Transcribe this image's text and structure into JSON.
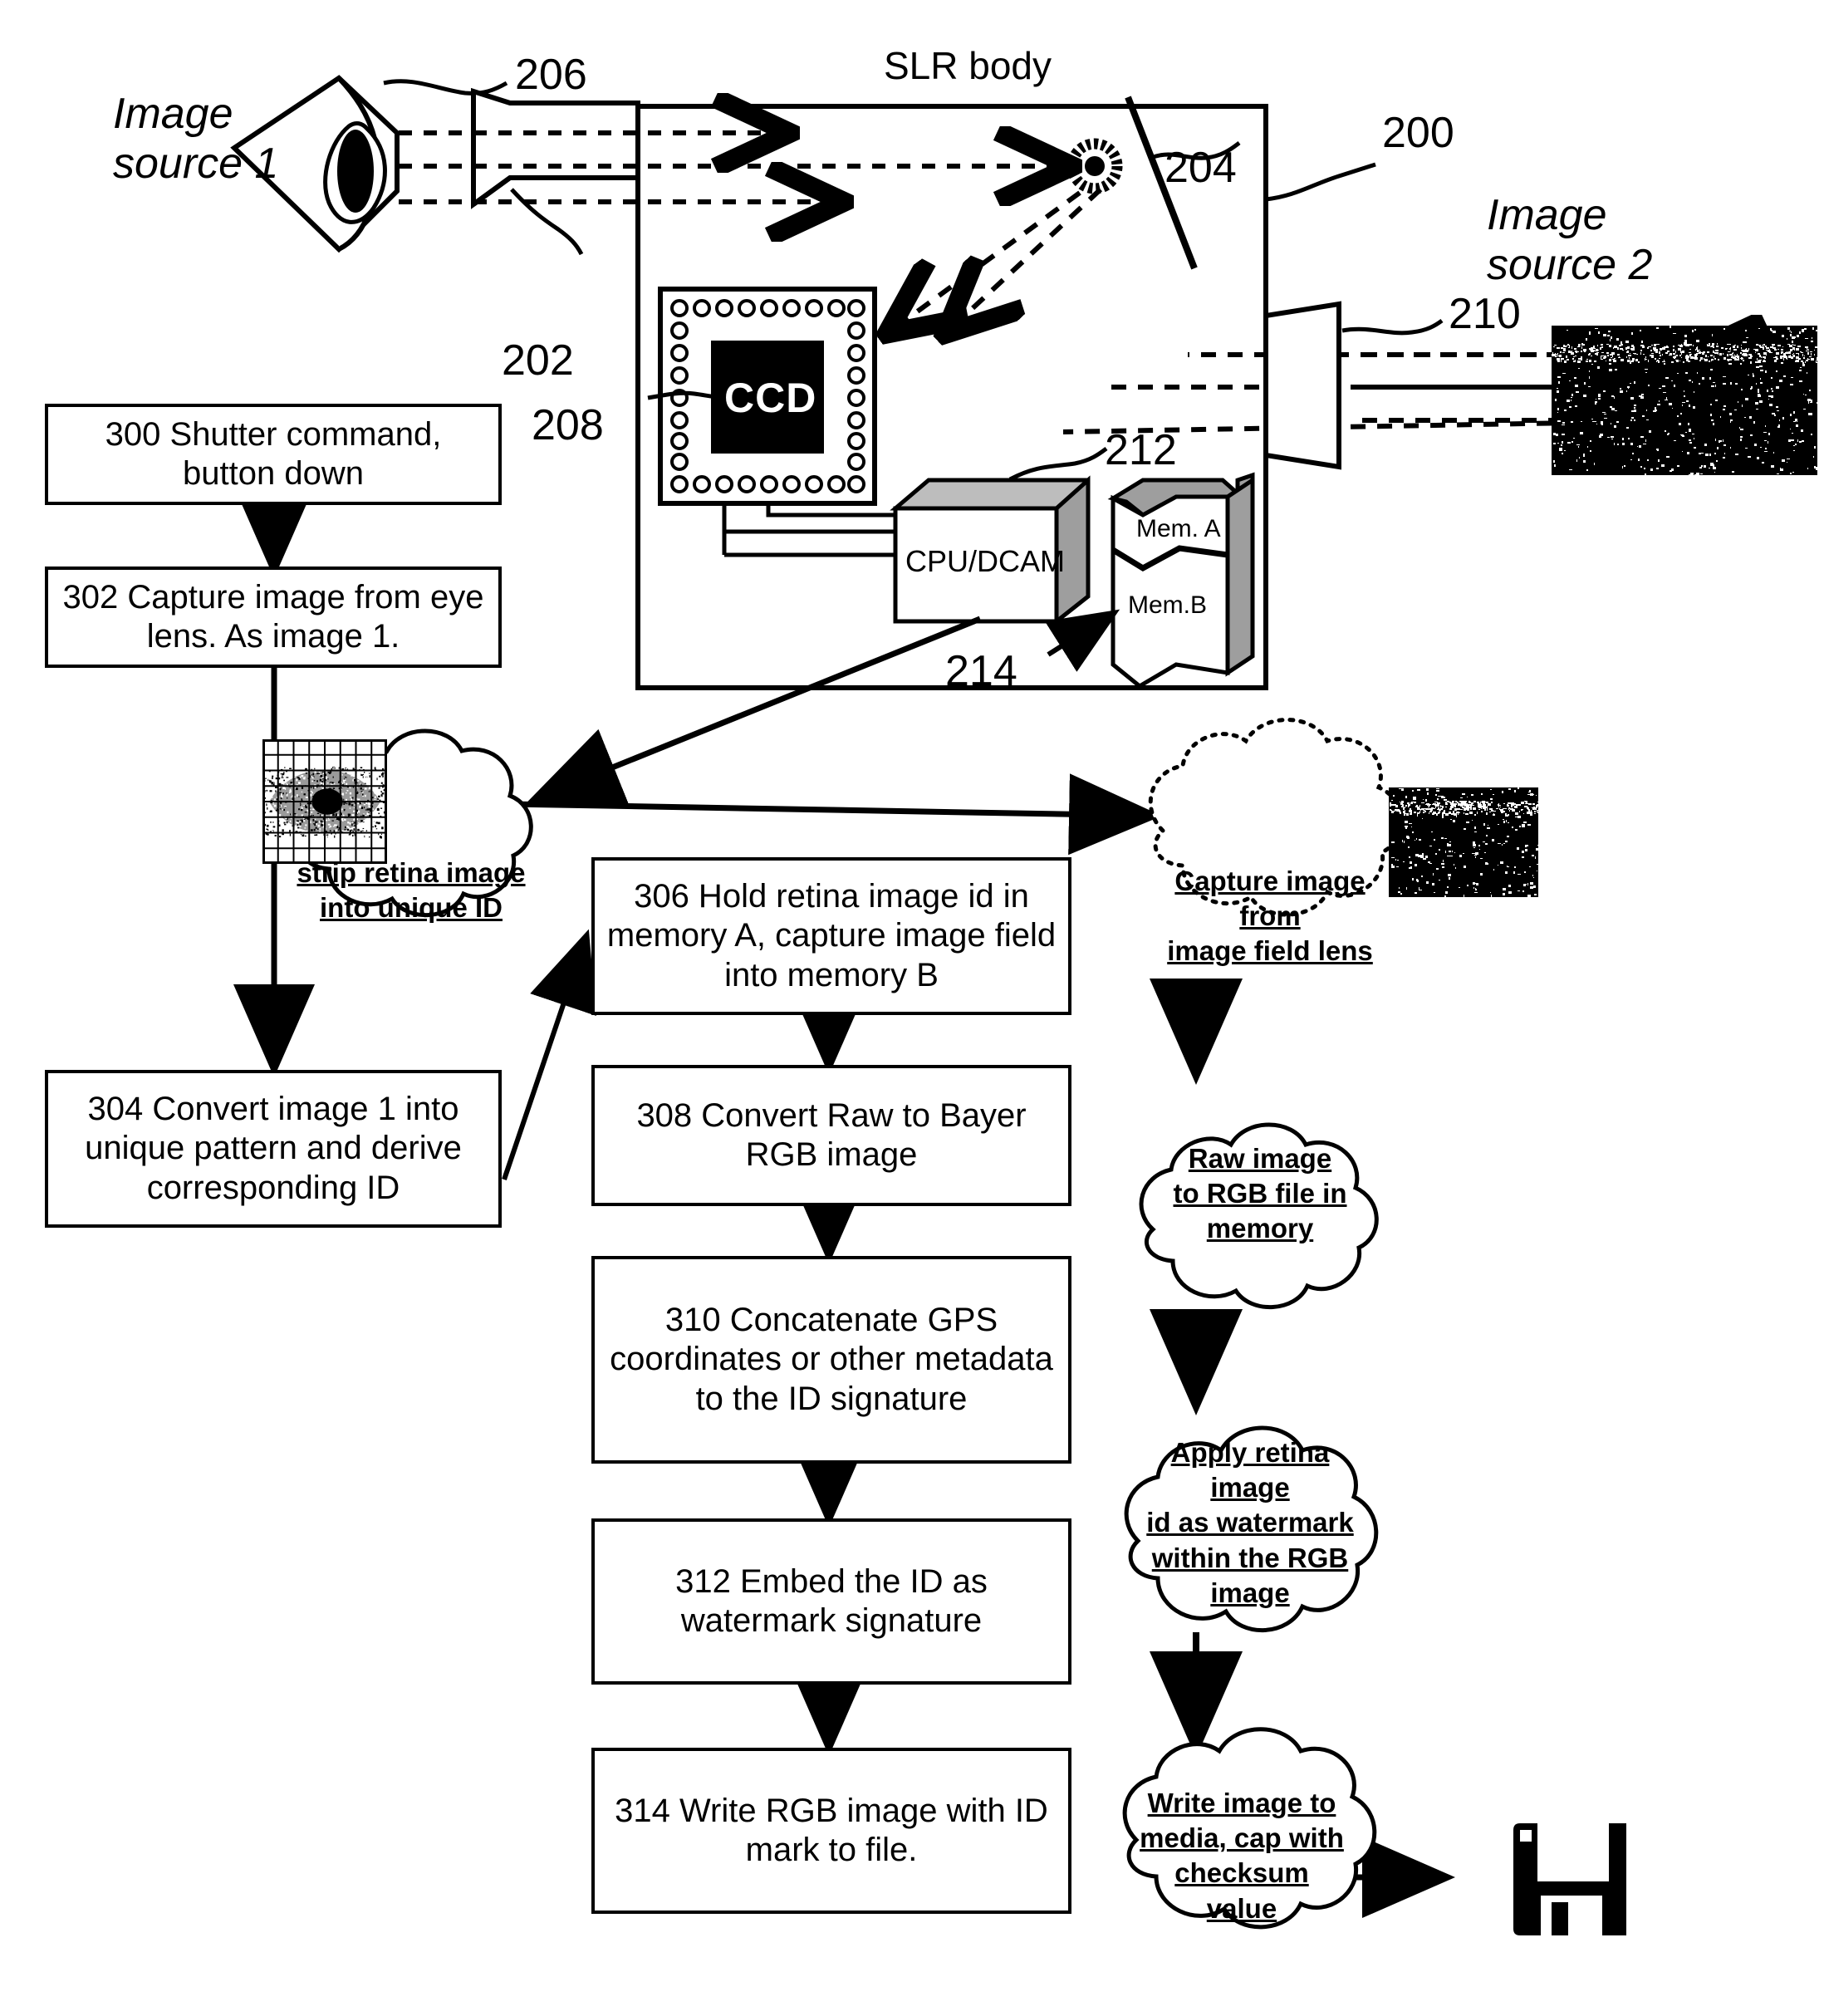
{
  "figure": {
    "title_slr": "SLR body",
    "image_source_1": "Image\nsource 1",
    "image_source_2": "Image\nsource 2",
    "ccd_label": "CCD",
    "cpu_label": "CPU/DCAM",
    "mem_a_label": "Mem. A",
    "mem_b_label": "Mem.B"
  },
  "reference_numerals": [
    {
      "id": "n200",
      "text": "200"
    },
    {
      "id": "n202",
      "text": "202"
    },
    {
      "id": "n204",
      "text": "204"
    },
    {
      "id": "n206",
      "text": "206"
    },
    {
      "id": "n208",
      "text": "208"
    },
    {
      "id": "n210",
      "text": "210"
    },
    {
      "id": "n212",
      "text": "212"
    },
    {
      "id": "n214",
      "text": "214"
    }
  ],
  "flow_boxes": [
    {
      "id": "b300",
      "text": "300 Shutter command, button down"
    },
    {
      "id": "b302",
      "text": "302 Capture image from eye lens. As image 1."
    },
    {
      "id": "b304",
      "text": "304 Convert image 1 into unique pattern and derive corresponding ID"
    },
    {
      "id": "b306",
      "text": "306 Hold retina image id in memory A, capture image field into memory B"
    },
    {
      "id": "b308",
      "text": "308 Convert Raw to Bayer RGB image"
    },
    {
      "id": "b310",
      "text": "310 Concatenate GPS coordinates or other metadata to the ID signature"
    },
    {
      "id": "b312",
      "text": "312 Embed the ID as watermark signature"
    },
    {
      "id": "b314",
      "text": "314 Write RGB image with ID mark to file."
    }
  ],
  "clouds": [
    {
      "id": "c1",
      "lines": [
        "strip retina image",
        "into unique ID"
      ]
    },
    {
      "id": "c2",
      "lines": [
        "Capture image from",
        "image field lens"
      ]
    },
    {
      "id": "c3",
      "lines": [
        "Raw image",
        "to RGB file in",
        "memory"
      ]
    },
    {
      "id": "c4",
      "lines": [
        "Apply retina image",
        "id as watermark",
        "within the RGB",
        "image"
      ]
    },
    {
      "id": "c5",
      "lines": [
        "Write image to",
        "media, cap with",
        "checksum value"
      ]
    }
  ],
  "icons": {
    "floppy": "floppy-disk-icon",
    "eye": "eye-icon",
    "lens": "lens-icon",
    "mirror": "mirror-icon",
    "aperture": "aperture-icon",
    "ccd_chip": "ccd-sensor-icon",
    "retina_grid": "retina-grid-image",
    "photo_1": "photo-thumbnail-image-source-2",
    "photo_2": "photo-thumbnail-captured"
  },
  "colors": {
    "ink": "#000000",
    "paper": "#ffffff"
  }
}
